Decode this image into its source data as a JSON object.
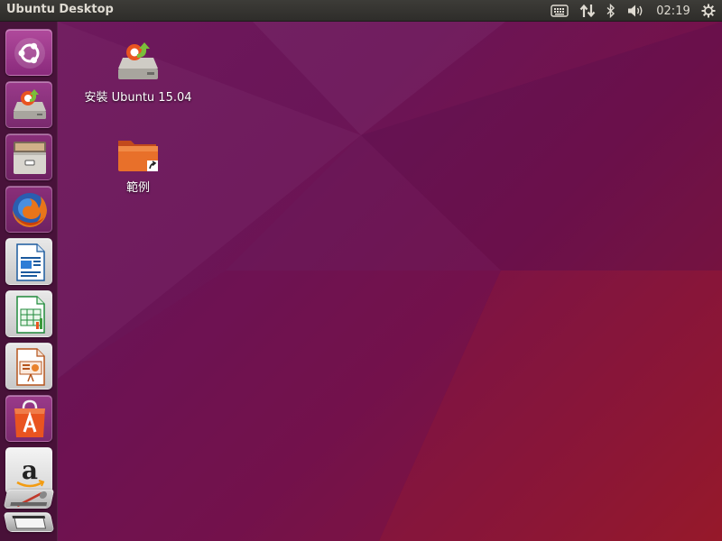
{
  "panel": {
    "title": "Ubuntu Desktop",
    "clock": "02:19"
  },
  "indicators": [
    {
      "icon": "keyboard-icon"
    },
    {
      "icon": "network-icon"
    },
    {
      "icon": "bluetooth-icon"
    },
    {
      "icon": "volume-icon"
    },
    {
      "icon": "session-gear-icon"
    }
  ],
  "launcher": {
    "items": [
      {
        "name": "dash",
        "icon": "ubuntu-logo-icon"
      },
      {
        "name": "install-ubuntu",
        "icon": "installer-icon"
      },
      {
        "name": "files",
        "icon": "file-cabinet-icon"
      },
      {
        "name": "firefox",
        "icon": "firefox-icon"
      },
      {
        "name": "writer",
        "icon": "libreoffice-writer-icon"
      },
      {
        "name": "calc",
        "icon": "libreoffice-calc-icon"
      },
      {
        "name": "impress",
        "icon": "libreoffice-impress-icon"
      },
      {
        "name": "software-center",
        "icon": "software-center-icon"
      },
      {
        "name": "amazon",
        "icon": "amazon-icon"
      },
      {
        "name": "system-settings",
        "icon": "settings-icon"
      },
      {
        "name": "trash",
        "icon": "trash-icon"
      }
    ]
  },
  "desktop": {
    "icons": [
      {
        "label": "安裝 Ubuntu 15.04",
        "icon": "installer-icon"
      },
      {
        "label": "範例",
        "icon": "folder-link-icon"
      }
    ]
  },
  "colors": {
    "panel": "#3d3c38",
    "panel_text": "#dfdbd2",
    "ubuntu_orange": "#e95420",
    "wallpaper_purple": "#6e1a5e",
    "wallpaper_red": "#9a1a22"
  }
}
